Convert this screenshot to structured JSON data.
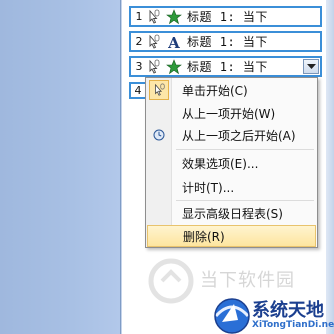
{
  "animation_list": [
    {
      "num": "1",
      "effect_icon": "star-effect-icon",
      "title": "标题 1: 当下"
    },
    {
      "num": "2",
      "effect_icon": "letter-a-effect-icon",
      "title": "标题 1: 当下"
    },
    {
      "num": "3",
      "effect_icon": "star-effect-icon",
      "title": "标题 1: 当下"
    }
  ],
  "row4_num": "4",
  "context_menu": {
    "items": [
      {
        "label": "单击开始(C)",
        "icon": "mouse-click-icon",
        "checked": true
      },
      {
        "label": "从上一项开始(W)",
        "icon": null
      },
      {
        "label": "从上一项之后开始(A)",
        "icon": "clock-icon"
      },
      {
        "label": "效果选项(E)...",
        "icon": null
      },
      {
        "label": "计时(T)...",
        "icon": null
      },
      {
        "label": "显示高级日程表(S)",
        "icon": null
      },
      {
        "label": "删除(R)",
        "icon": null,
        "hover": true
      }
    ]
  },
  "watermark": {
    "text": "当下软件园",
    "brand": "系统天地",
    "url": "XiTongTianDi.net"
  },
  "colors": {
    "selection_border": "#3b8fd8",
    "menu_hover": "#fde59f",
    "brand_blue": "#1b3f8f"
  }
}
